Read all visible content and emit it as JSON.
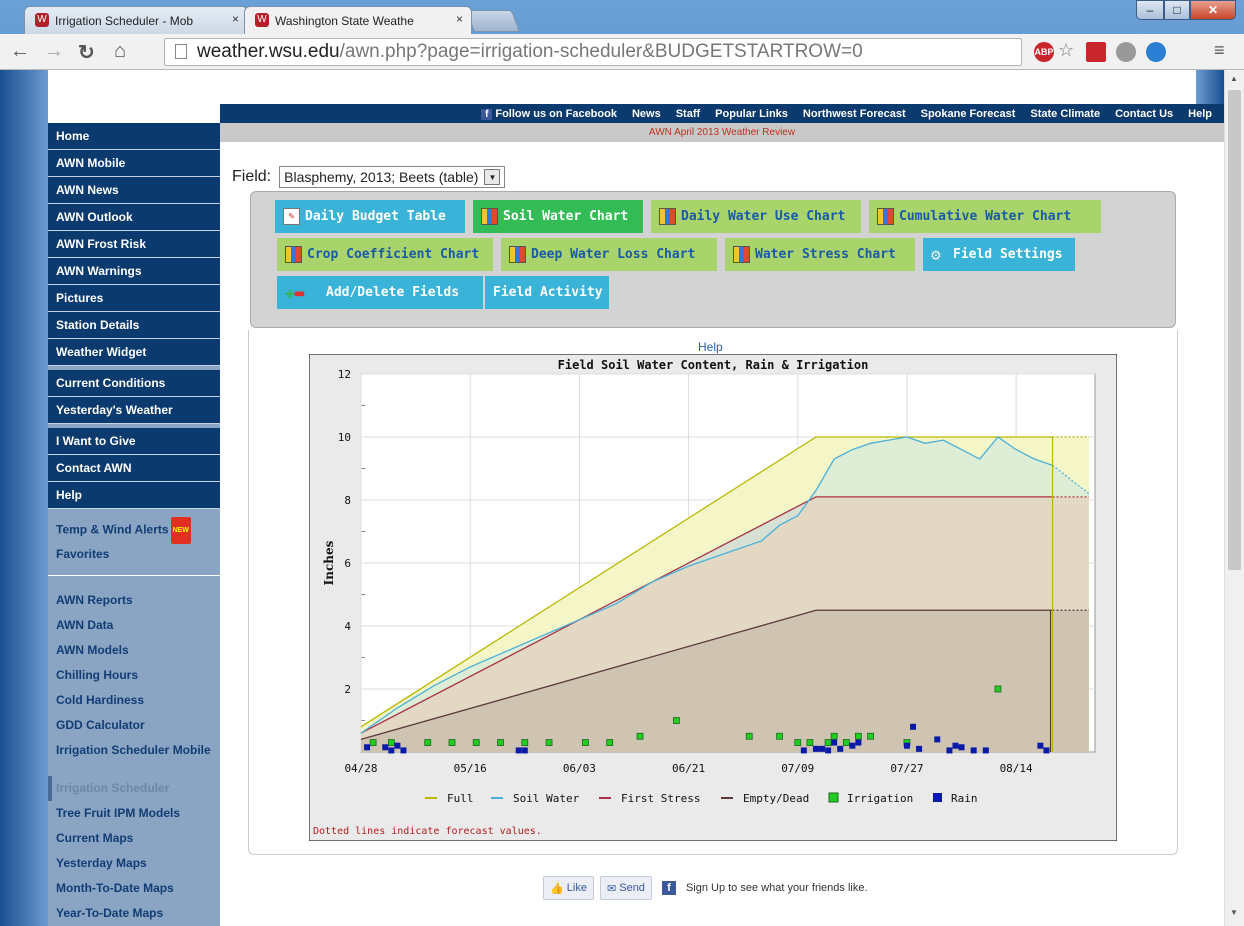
{
  "browser": {
    "tabs": [
      {
        "label": "Irrigation Scheduler - Mob",
        "active": false
      },
      {
        "label": "Washington State Weathe",
        "active": true
      }
    ],
    "close_glyph": "×",
    "url_host": "weather.wsu.edu",
    "url_path": "/awn.php?page=irrigation-scheduler&BUDGETSTARTROW=0",
    "extensions": [
      "ABP",
      "star",
      "pdf",
      "speech",
      "globe"
    ]
  },
  "topnav": [
    "Follow us on Facebook",
    "News",
    "Staff",
    "Popular Links",
    "Northwest Forecast",
    "Spokane Forecast",
    "State Climate",
    "Contact Us",
    "Help"
  ],
  "review_banner": "AWN April 2013 Weather Review",
  "sidebar": {
    "primary": [
      "Home",
      "AWN Mobile",
      "AWN News",
      "AWN Outlook",
      "AWN Frost Risk",
      "AWN Warnings",
      "Pictures",
      "Station Details",
      "Weather Widget"
    ],
    "group2": [
      "Current Conditions",
      "Yesterday's Weather"
    ],
    "group3": [
      "I Want to Give",
      "Contact AWN",
      "Help"
    ],
    "light1": [
      "Temp & Wind Alerts",
      "Favorites"
    ],
    "light2": [
      "AWN Reports",
      "AWN Data",
      "AWN Models",
      "Chilling Hours",
      "Cold Hardiness",
      "GDD Calculator",
      "Irrigation Scheduler Mobile",
      "Irrigation Scheduler",
      "Tree Fruit IPM Models",
      "Current Maps",
      "Yesterday Maps",
      "Month-To-Date Maps",
      "Year-To-Date Maps"
    ],
    "current": "Irrigation Scheduler",
    "new_badge": "NEW"
  },
  "field": {
    "label": "Field:",
    "value": "Blasphemy, 2013; Beets (table)"
  },
  "buttons": {
    "daily_budget": "Daily Budget Table",
    "soil_water": "Soil Water Chart",
    "daily_water_use": "Daily Water Use Chart",
    "cumulative": "Cumulative Water Chart",
    "crop_coeff": "Crop Coefficient Chart",
    "deep_loss": "Deep Water Loss Chart",
    "water_stress": "Water Stress Chart",
    "field_settings": "Field Settings",
    "add_delete": "Add/Delete Fields",
    "field_activity": "Field Activity"
  },
  "help_link": "Help",
  "social": {
    "like": "Like",
    "send": "Send",
    "text": "Sign Up to see what your friends like."
  },
  "colors": {
    "full": "#b8b800",
    "soil": "#4ab0d8",
    "first_stress": "#a83246",
    "empty": "#5a3a3a",
    "irrigation": "#22cc22",
    "rain": "#0a1aa8"
  },
  "chart_data": {
    "type": "line",
    "title": "Field Soil Water Content, Rain & Irrigation",
    "ylabel": "Inches",
    "xlabel": "",
    "ylim": [
      0,
      12
    ],
    "xlim": [
      "04/28",
      "08/27"
    ],
    "x_ticks": [
      "04/28",
      "05/16",
      "06/03",
      "06/21",
      "07/09",
      "07/27",
      "08/14"
    ],
    "y_ticks": [
      "2",
      "4",
      "6",
      "8",
      "10",
      "12"
    ],
    "grid": true,
    "note": "Dotted lines indicate forecast values.",
    "legend": [
      "Full",
      "Soil Water",
      "First Stress",
      "Empty/Dead",
      "Irrigation",
      "Rain"
    ],
    "legend_position": "bottom",
    "series": [
      {
        "name": "Full",
        "points": [
          [
            "04/28",
            0.8
          ],
          [
            "07/12",
            10
          ],
          [
            "08/20",
            10
          ]
        ],
        "forecast": [
          [
            "08/20",
            10
          ],
          [
            "08/26",
            10
          ]
        ]
      },
      {
        "name": "First Stress",
        "points": [
          [
            "04/28",
            0.6
          ],
          [
            "07/12",
            8.1
          ],
          [
            "08/20",
            8.1
          ]
        ],
        "forecast": [
          [
            "08/20",
            8.1
          ],
          [
            "08/26",
            8.1
          ]
        ]
      },
      {
        "name": "Empty/Dead",
        "points": [
          [
            "04/28",
            0.4
          ],
          [
            "07/12",
            4.5
          ],
          [
            "08/20",
            4.5
          ]
        ],
        "forecast": [
          [
            "08/20",
            4.5
          ],
          [
            "08/26",
            4.5
          ]
        ]
      },
      {
        "name": "Soil Water",
        "points": [
          [
            "04/28",
            0.6
          ],
          [
            "05/04",
            1.4
          ],
          [
            "05/10",
            2.1
          ],
          [
            "05/16",
            2.7
          ],
          [
            "05/22",
            3.2
          ],
          [
            "05/28",
            3.7
          ],
          [
            "06/03",
            4.2
          ],
          [
            "06/09",
            4.7
          ],
          [
            "06/15",
            5.4
          ],
          [
            "06/21",
            5.9
          ],
          [
            "06/27",
            6.3
          ],
          [
            "07/03",
            6.7
          ],
          [
            "07/06",
            7.2
          ],
          [
            "07/09",
            7.5
          ],
          [
            "07/12",
            8.3
          ],
          [
            "07/15",
            9.3
          ],
          [
            "07/18",
            9.6
          ],
          [
            "07/21",
            9.8
          ],
          [
            "07/24",
            9.9
          ],
          [
            "07/27",
            10.0
          ],
          [
            "07/30",
            9.8
          ],
          [
            "08/02",
            9.9
          ],
          [
            "08/05",
            9.6
          ],
          [
            "08/08",
            9.3
          ],
          [
            "08/11",
            10.0
          ],
          [
            "08/14",
            9.6
          ],
          [
            "08/17",
            9.3
          ],
          [
            "08/20",
            9.1
          ]
        ],
        "forecast": [
          [
            "08/20",
            9.1
          ],
          [
            "08/26",
            8.2
          ]
        ]
      }
    ],
    "irrigation": [
      [
        "04/30",
        0.3
      ],
      [
        "05/03",
        0.3
      ],
      [
        "05/09",
        0.3
      ],
      [
        "05/13",
        0.3
      ],
      [
        "05/17",
        0.3
      ],
      [
        "05/21",
        0.3
      ],
      [
        "05/25",
        0.3
      ],
      [
        "05/29",
        0.3
      ],
      [
        "06/04",
        0.3
      ],
      [
        "06/08",
        0.3
      ],
      [
        "06/13",
        0.5
      ],
      [
        "06/19",
        1.0
      ],
      [
        "07/01",
        0.5
      ],
      [
        "07/06",
        0.5
      ],
      [
        "07/09",
        0.3
      ],
      [
        "07/11",
        0.3
      ],
      [
        "07/14",
        0.3
      ],
      [
        "07/15",
        0.5
      ],
      [
        "07/17",
        0.3
      ],
      [
        "07/19",
        0.5
      ],
      [
        "07/21",
        0.5
      ],
      [
        "07/27",
        0.3
      ],
      [
        "08/11",
        2.0
      ]
    ],
    "rain": [
      [
        "04/29",
        0.15
      ],
      [
        "05/02",
        0.15
      ],
      [
        "05/03",
        0.05
      ],
      [
        "05/04",
        0.2
      ],
      [
        "05/05",
        0.05
      ],
      [
        "05/24",
        0.05
      ],
      [
        "05/25",
        0.05
      ],
      [
        "07/10",
        0.05
      ],
      [
        "07/12",
        0.1
      ],
      [
        "07/13",
        0.1
      ],
      [
        "07/14",
        0.05
      ],
      [
        "07/15",
        0.3
      ],
      [
        "07/16",
        0.1
      ],
      [
        "07/18",
        0.2
      ],
      [
        "07/19",
        0.3
      ],
      [
        "07/27",
        0.2
      ],
      [
        "07/28",
        0.8
      ],
      [
        "07/29",
        0.1
      ],
      [
        "08/01",
        0.4
      ],
      [
        "08/03",
        0.05
      ],
      [
        "08/04",
        0.2
      ],
      [
        "08/05",
        0.15
      ],
      [
        "08/07",
        0.05
      ],
      [
        "08/09",
        0.05
      ],
      [
        "08/18",
        0.2
      ],
      [
        "08/19",
        0.05
      ]
    ]
  }
}
